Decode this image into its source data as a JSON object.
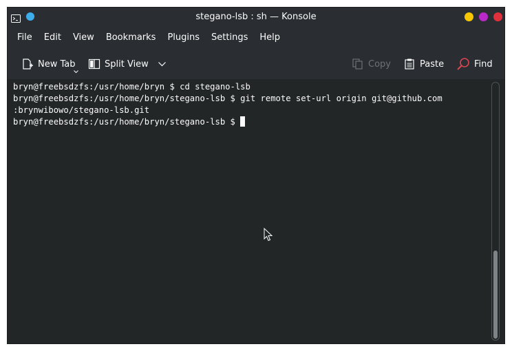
{
  "window": {
    "title": "stegano-lsb : sh — Konsole",
    "accent": "#3daee9",
    "buttons": {
      "minimize": "#f7c600",
      "maximize": "#b928c8",
      "close": "#e0303c"
    }
  },
  "menu": [
    "File",
    "Edit",
    "View",
    "Bookmarks",
    "Plugins",
    "Settings",
    "Help"
  ],
  "toolbar": {
    "new_tab": "New Tab",
    "split_view": "Split View",
    "copy": "Copy",
    "paste": "Paste",
    "find": "Find"
  },
  "terminal": {
    "lines": [
      "bryn@freebsdzfs:/usr/home/bryn $ cd stegano-lsb",
      "bryn@freebsdzfs:/usr/home/bryn/stegano-lsb $ git remote set-url origin git@github.com",
      ":brynwibowo/stegano-lsb.git",
      "bryn@freebsdzfs:/usr/home/bryn/stegano-lsb $ "
    ]
  },
  "icons": {
    "app": "konsole-icon",
    "pin": "pin-icon",
    "new_tab": "new-tab-icon",
    "split_view": "split-view-icon",
    "copy": "copy-icon",
    "paste": "paste-icon",
    "find": "search-icon"
  }
}
